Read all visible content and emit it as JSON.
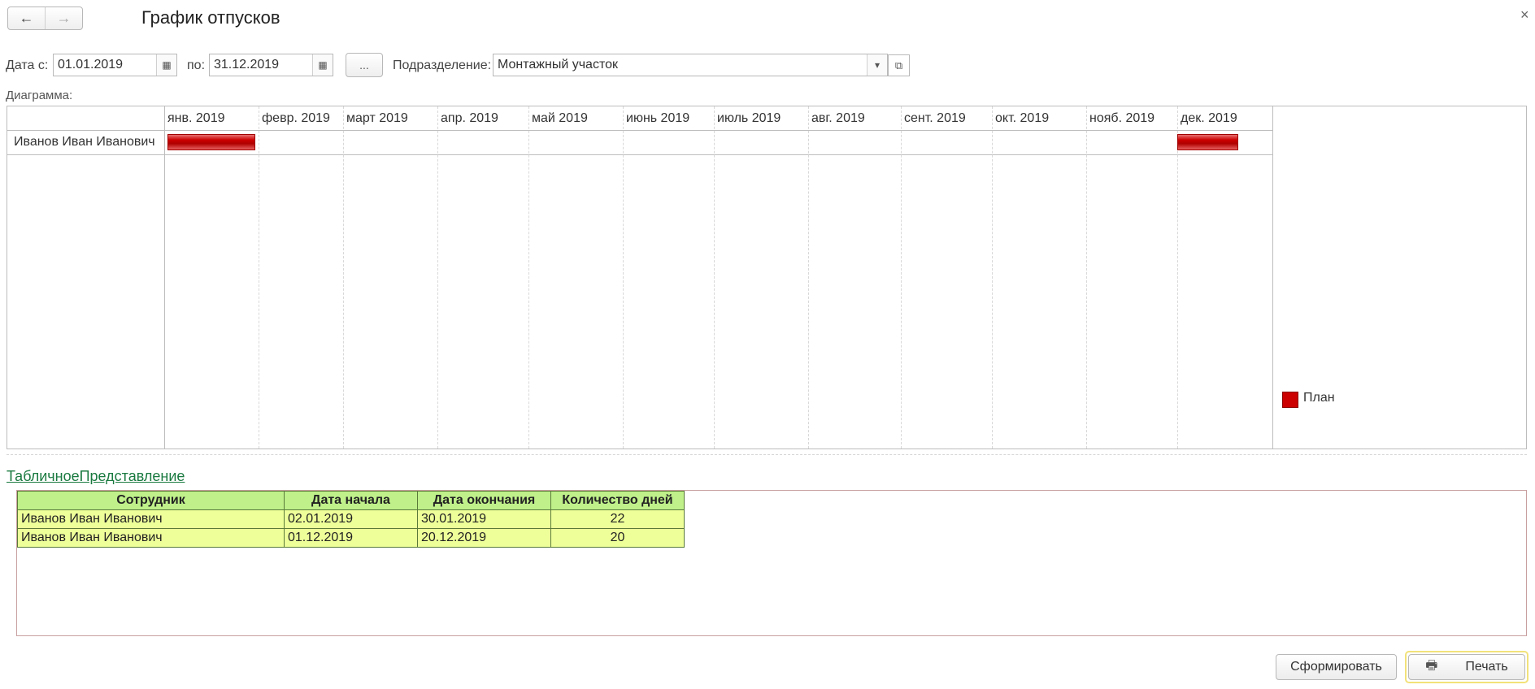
{
  "window": {
    "title": "График отпусков",
    "back_icon": "←",
    "forward_icon": "→",
    "close_icon": "×"
  },
  "filters": {
    "date_from_label": "Дата с:",
    "date_from_value": "01.01.2019",
    "date_to_label": "по:",
    "date_to_value": "31.12.2019",
    "period_button_label": "...",
    "department_label": "Подразделение:",
    "department_value": "Монтажный участок",
    "calendar_icon": "▦",
    "dropdown_icon": "▾",
    "open_icon": "⧉"
  },
  "diagram": {
    "label": "Диаграмма:",
    "months": [
      "янв. 2019",
      "февр. 2019",
      "март 2019",
      "апр. 2019",
      "май 2019",
      "июнь 2019",
      "июль 2019",
      "авг. 2019",
      "сент. 2019",
      "окт. 2019",
      "нояб. 2019",
      "дек. 2019"
    ],
    "rows": [
      {
        "name": "Иванов Иван Иванович",
        "intervals": [
          {
            "start": "2019-01-02",
            "end": "2019-01-30"
          },
          {
            "start": "2019-12-01",
            "end": "2019-12-20"
          }
        ]
      }
    ],
    "legend": [
      {
        "name": "План",
        "color": "#cc0000"
      }
    ]
  },
  "table_section": {
    "link_label": "ТабличноеПредставление",
    "headers": [
      "Сотрудник",
      "Дата начала",
      "Дата окончания",
      "Количество дней"
    ],
    "rows": [
      [
        "Иванов Иван Иванович",
        "02.01.2019",
        "30.01.2019",
        "22"
      ],
      [
        "Иванов Иван Иванович",
        "01.12.2019",
        "20.12.2019",
        "20"
      ]
    ]
  },
  "actions": {
    "generate_label": "Сформировать",
    "print_label": "Печать",
    "printer_icon": "🖶"
  }
}
